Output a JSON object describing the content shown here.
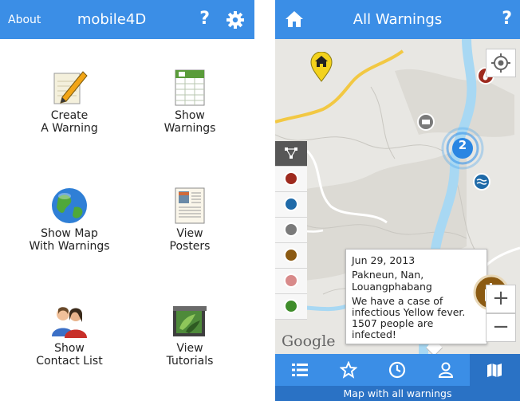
{
  "menu_screen": {
    "header": {
      "about_label": "About",
      "title": "mobile4D",
      "help_label": "?"
    },
    "tiles": [
      {
        "line1": "Create",
        "line2": "A Warning"
      },
      {
        "line1": "Show",
        "line2": "Warnings"
      },
      {
        "line1": "Show Map",
        "line2": "With Warnings"
      },
      {
        "line1": "View",
        "line2": "Posters"
      },
      {
        "line1": "Show",
        "line2": "Contact List"
      },
      {
        "line1": "View",
        "line2": "Tutorials"
      }
    ]
  },
  "map_screen": {
    "header": {
      "title": "All Warnings",
      "help_label": "?"
    },
    "cluster_count": "2",
    "popup": {
      "date": "Jun 29, 2013",
      "location": "Pakneun, Nan, Louangphabang",
      "message": "We have a case of infectious Yellow fever. 1507 people are infected!"
    },
    "zoom_in_label": "+",
    "zoom_out_label": "−",
    "attribution": "Google",
    "footer_label": "Map with all warnings",
    "layer_colors": [
      "#9e2a1e",
      "#1f6aa8",
      "#7a7a7a",
      "#8b5a12",
      "#d88a8a",
      "#3e8c2a"
    ]
  },
  "colors": {
    "primary": "#3b8ee6",
    "primary_dark": "#2a72c5",
    "river": "#a8d8f3",
    "road": "#f2c843"
  }
}
